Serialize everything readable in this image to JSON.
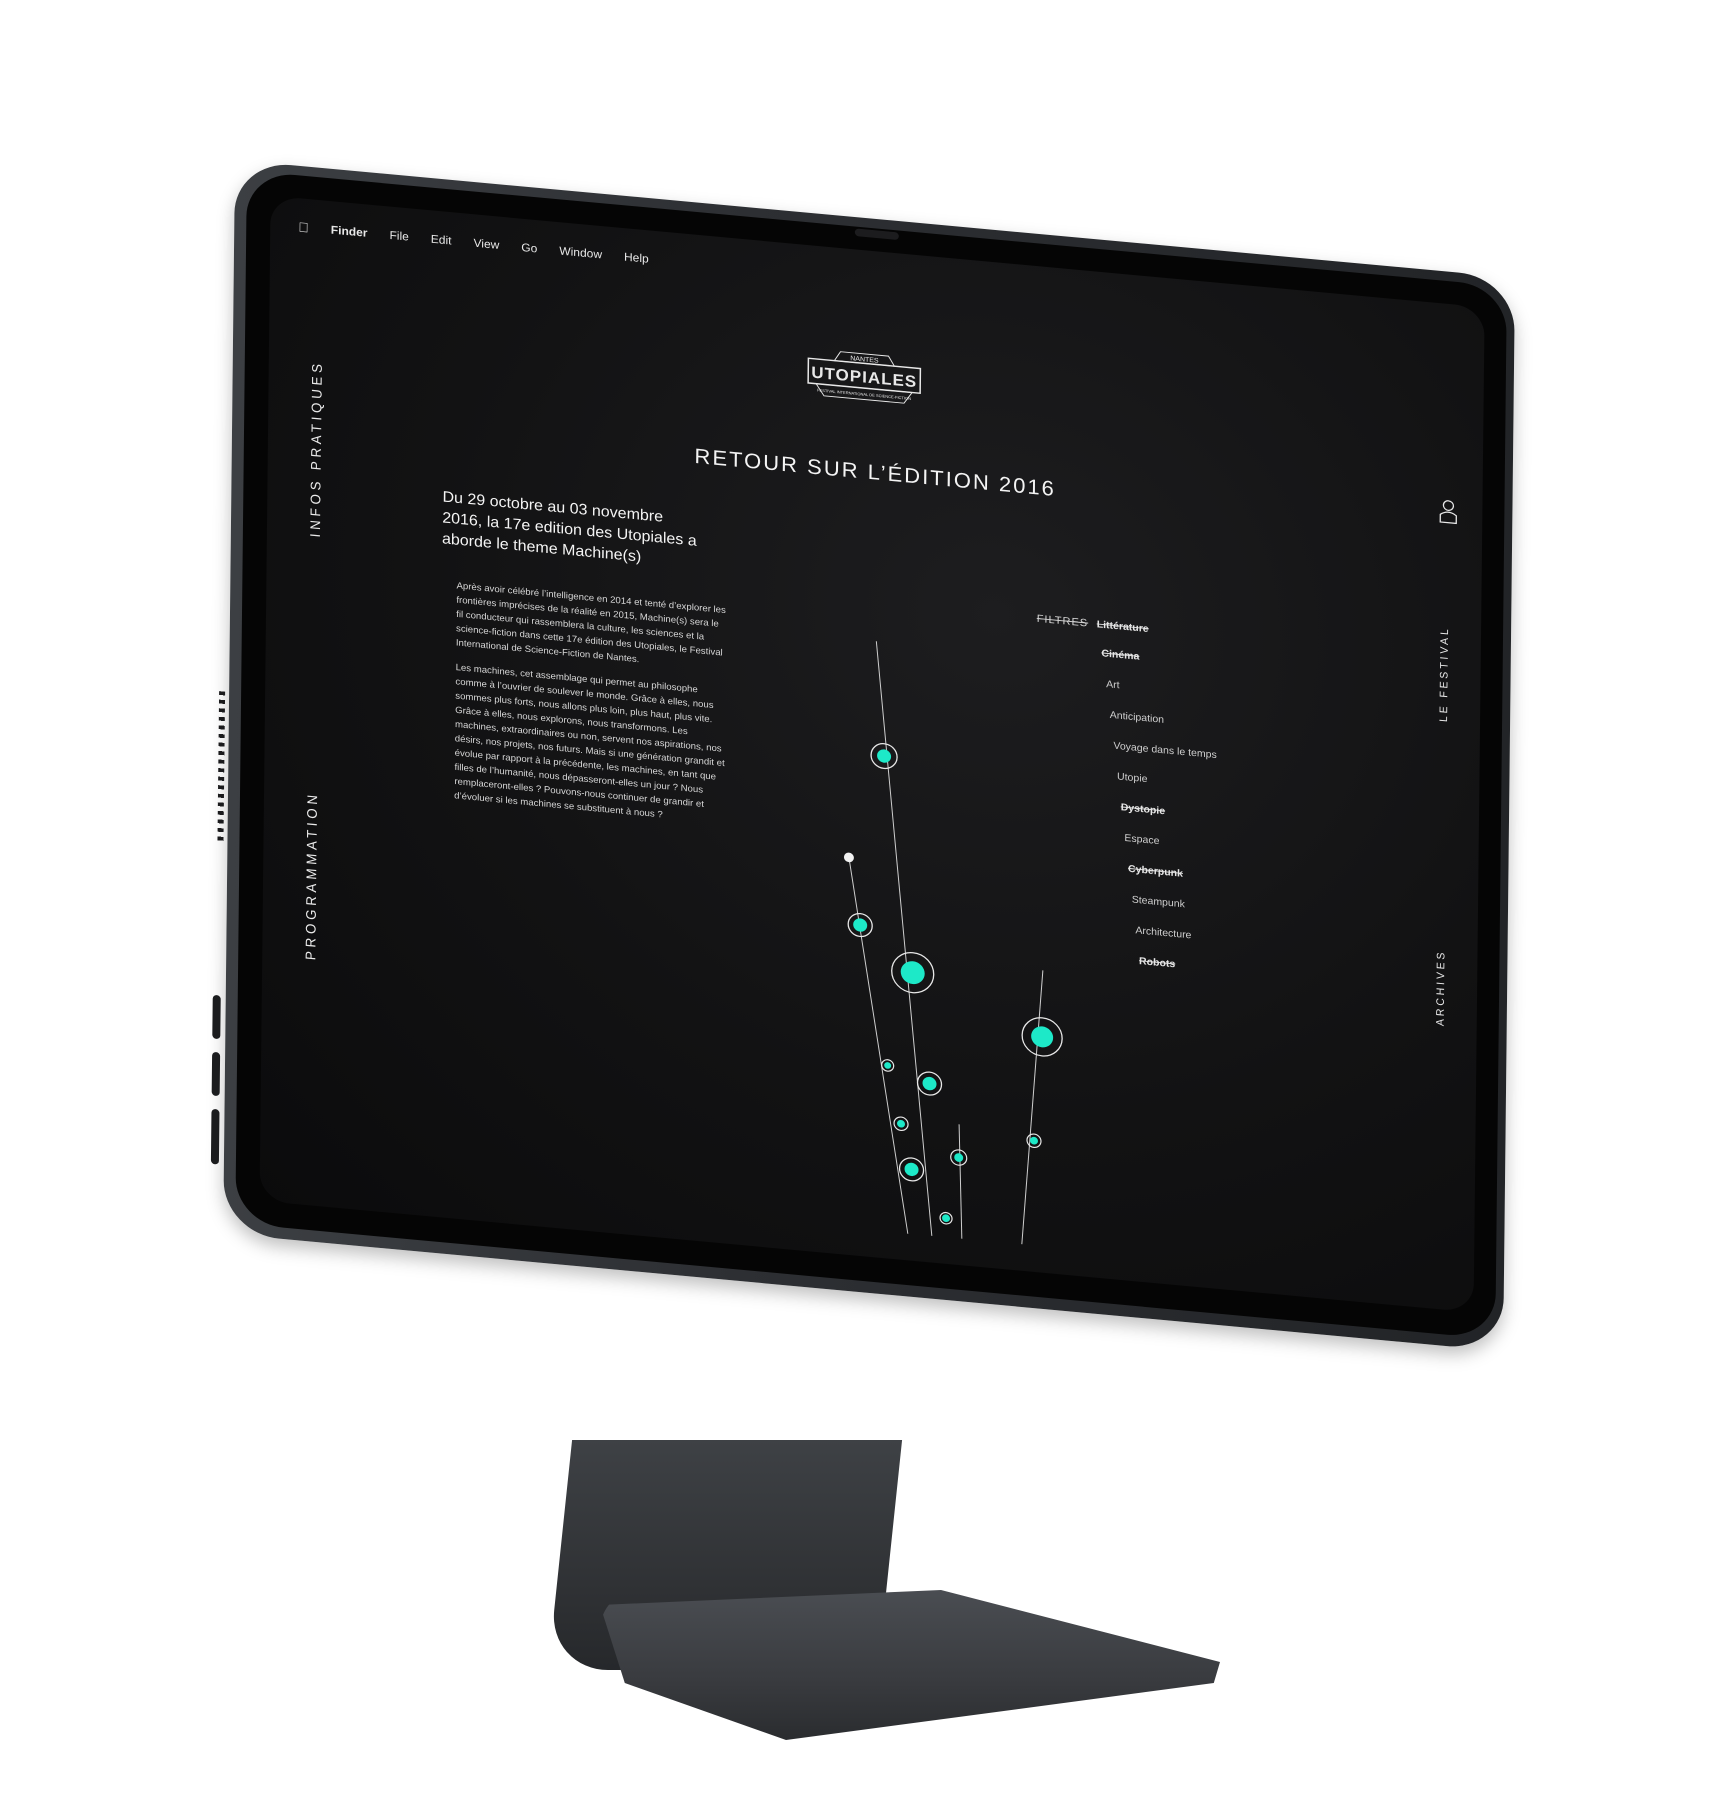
{
  "menubar": {
    "apple_icon": "apple-icon",
    "items": [
      "Finder",
      "File",
      "Edit",
      "View",
      "Go",
      "Window",
      "Help"
    ]
  },
  "logo": {
    "top": "NANTES",
    "name": "UTOPIALES",
    "sub": "FESTIVAL INTERNATIONAL DE SCIENCE-FICTION"
  },
  "page_title": "RETOUR SUR L’ÉDITION 2016",
  "side_nav": {
    "left_top": "INFOS PRATIQUES",
    "left_bottom": "PROGRAMMATION",
    "right_top": "LE FESTIVAL",
    "right_bottom": "ARCHIVES"
  },
  "intro": "Du 29 octobre au 03 novembre 2016, la 17e edition des Utopiales a aborde le theme Machine(s)",
  "body": {
    "p1": "Après avoir célébré l’intelligence en 2014 et tenté d’explorer les frontières imprécises de la réalité en 2015, Machine(s) sera le fil conducteur qui rassemblera la culture, les sciences et la science-fiction dans cette 17e édition des Utopiales, le Festival International de Science-Fiction de Nantes.",
    "p2": "Les machines, cet assemblage qui permet au philosophe comme à l’ouvrier de soulever le monde. Grâce à elles, nous sommes plus forts, nous allons plus loin, plus haut, plus vite. Grâce à elles, nous explorons, nous transformons. Les machines, extraordinaires ou non, servent nos aspirations, nos désirs, nos projets, nos futurs. Mais si une génération grandit et évolue par rapport à la précédente, les machines, en tant que filles de l’humanité, nous dépasseront-elles un jour ? Nous remplaceront-elles ? Pouvons-nous continuer de grandir et d’évoluer si les machines se substituent à nous ?"
  },
  "filters": {
    "label": "FILTRES",
    "items": [
      {
        "label": "Littérature",
        "active": false
      },
      {
        "label": "Cinéma",
        "active": false
      },
      {
        "label": "Art",
        "active": true
      },
      {
        "label": "Anticipation",
        "active": true
      },
      {
        "label": "Voyage dans le temps",
        "active": true
      },
      {
        "label": "Utopie",
        "active": true
      },
      {
        "label": "Dystopie",
        "active": false
      },
      {
        "label": "Espace",
        "active": true
      },
      {
        "label": "Cyberpunk",
        "active": false
      },
      {
        "label": "Steampunk",
        "active": true
      },
      {
        "label": "Architecture",
        "active": true
      },
      {
        "label": "Robots",
        "active": false
      }
    ]
  },
  "colors": {
    "accent": "#1de9c8",
    "screen_bg": "#111112",
    "device_body": "#2d2f33",
    "text": "#f2f2f2"
  },
  "icons": {
    "user": "user-icon"
  }
}
